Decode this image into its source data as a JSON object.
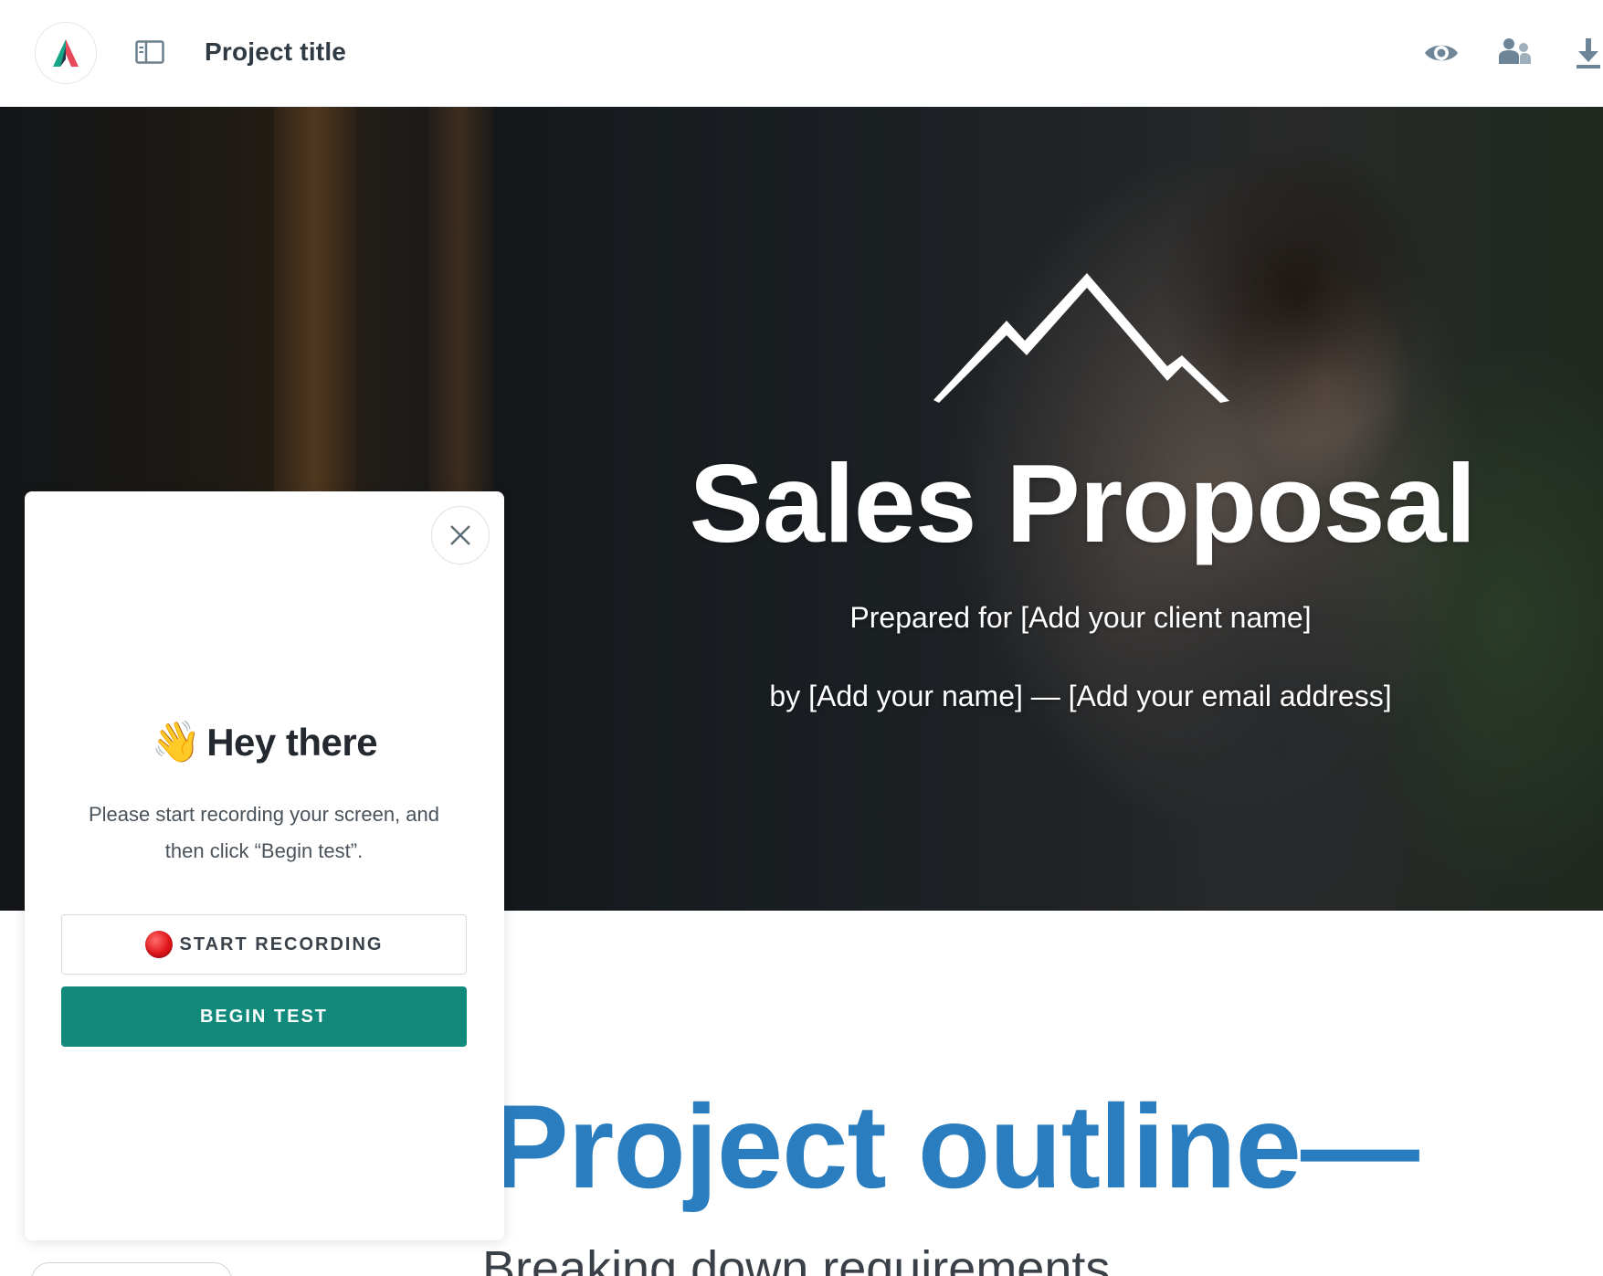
{
  "header": {
    "project_title": "Project title",
    "icons": [
      "app-logo-icon",
      "sidebar-toggle-icon",
      "eye-icon",
      "share-users-icon",
      "download-icon"
    ]
  },
  "hero": {
    "title": "Sales Proposal",
    "prepared_for": "Prepared for [Add your client name]",
    "byline": "by [Add your name] — [Add your email address]"
  },
  "content": {
    "section_heading": "Project outline—",
    "section_subheading": "Breaking down requirements"
  },
  "panel": {
    "wave_emoji": "👋",
    "greeting": "Hey there",
    "instructions": "Please start recording your screen, and then click “Begin test”.",
    "start_recording_label": "START RECORDING",
    "begin_test_label": "BEGIN TEST"
  },
  "colors": {
    "accent_teal": "#118a7b",
    "heading_blue": "#2a7dbf",
    "record_red": "#e0161a"
  }
}
